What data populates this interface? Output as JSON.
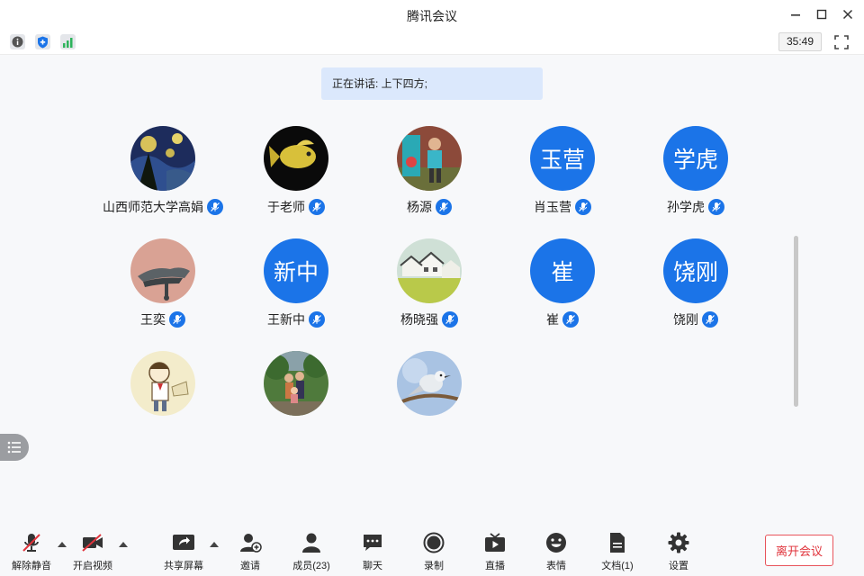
{
  "window": {
    "title": "腾讯会议"
  },
  "infobar": {
    "timer": "35:49"
  },
  "speaking": {
    "text": "正在讲话: 上下四方;"
  },
  "participants": [
    {
      "name": "山西师范大学高娟",
      "avatar_type": "photo",
      "photo": "starry-night"
    },
    {
      "name": "于老师",
      "avatar_type": "photo",
      "photo": "goldfish"
    },
    {
      "name": "杨源",
      "avatar_type": "photo",
      "photo": "child-playground"
    },
    {
      "name": "肖玉营",
      "avatar_type": "text",
      "avatar_text": "玉营"
    },
    {
      "name": "孙学虎",
      "avatar_type": "text",
      "avatar_text": "学虎"
    },
    {
      "name": "王奕",
      "avatar_type": "photo",
      "photo": "roof-dragon"
    },
    {
      "name": "王新中",
      "avatar_type": "text",
      "avatar_text": "新中"
    },
    {
      "name": "杨晓强",
      "avatar_type": "photo",
      "photo": "village-painting"
    },
    {
      "name": "崔",
      "avatar_type": "text",
      "avatar_text": "崔"
    },
    {
      "name": "饶刚",
      "avatar_type": "text",
      "avatar_text": "饶刚"
    },
    {
      "name": "",
      "avatar_type": "photo",
      "photo": "cartoon-boy"
    },
    {
      "name": "",
      "avatar_type": "photo",
      "photo": "family-park"
    },
    {
      "name": "",
      "avatar_type": "photo",
      "photo": "bird-branch"
    }
  ],
  "toolbar": {
    "mute": "解除静音",
    "video": "开启视频",
    "share": "共享屏幕",
    "invite": "邀请",
    "members": "成员(23)",
    "chat": "聊天",
    "record": "录制",
    "live": "直播",
    "emoji": "表情",
    "docs": "文档(1)",
    "settings": "设置",
    "leave": "离开会议"
  },
  "colors": {
    "accent": "#1b74e8",
    "leave_red": "#e0343c",
    "banner": "#dbe8fc"
  }
}
